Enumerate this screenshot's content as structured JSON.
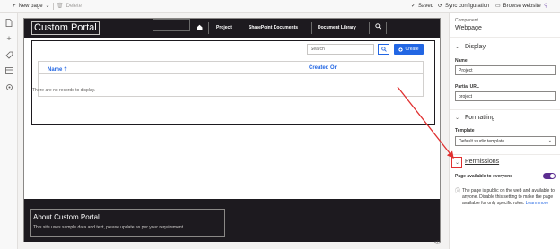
{
  "toolbar": {
    "new_page": "New page",
    "delete": "Delete",
    "saved": "Saved",
    "sync": "Sync configuration",
    "browse": "Browse website"
  },
  "site": {
    "title": "Custom Portal",
    "nav": [
      "Project",
      "SharePoint Documents",
      "Document Library"
    ],
    "search_placeholder": "Search",
    "create_label": "Create",
    "columns": [
      "Name",
      "Created On"
    ],
    "empty_message": "There are no records to display.",
    "footer_title": "About Custom Portal",
    "footer_text": "This site uses sample data and text, please update as per your requirement.",
    "bottom_glyph": "</>"
  },
  "panel": {
    "kind": "Component",
    "name": "Webpage",
    "display_section": "Display",
    "name_label": "Name",
    "name_value": "Project",
    "url_label": "Partial URL",
    "url_value": "project",
    "formatting_section": "Formatting",
    "template_label": "Template",
    "template_value": "Default studio template",
    "permissions_section": "Permissions",
    "toggle_label": "Page available to everyone",
    "toggle_on": true,
    "info_text": "The page is public on the web and available to anyone. Disable this setting to make the page available for only specific roles.",
    "learn_more": "Learn more"
  },
  "annotation": {
    "color": "#e03030"
  }
}
